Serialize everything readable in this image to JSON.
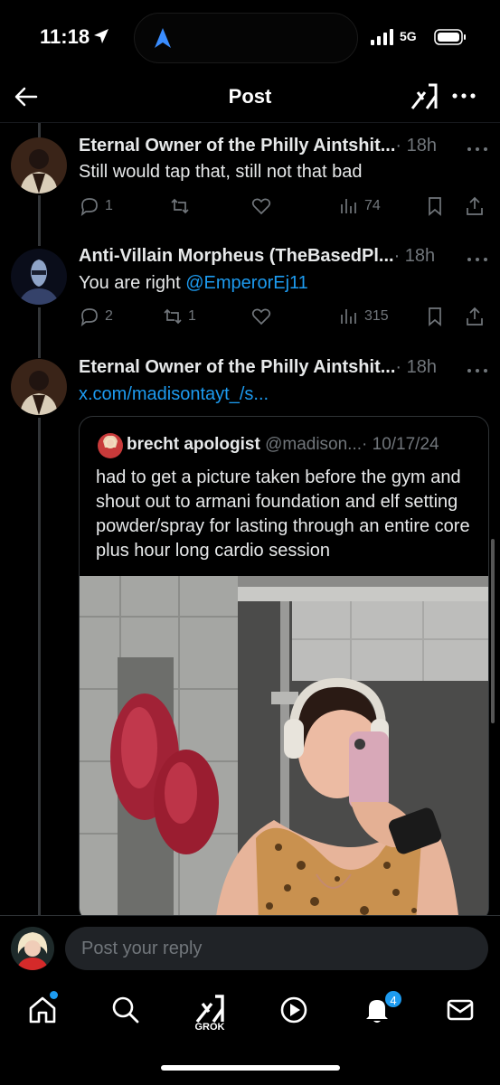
{
  "status_bar": {
    "time": "11:18",
    "network": "5G"
  },
  "header": {
    "title": "Post"
  },
  "tweets": [
    {
      "name": "Eternal Owner of the Philly Aintshit...",
      "time": "· 18h",
      "text": "Still would tap that, still not that bad",
      "replies": "1",
      "retweets": "",
      "likes": "",
      "views": "74"
    },
    {
      "name": "Anti-Villain Morpheus (TheBasedPl...",
      "time": "· 18h",
      "text_prefix": "You are right ",
      "mention": "@EmperorEj11",
      "replies": "2",
      "retweets": "1",
      "likes": "",
      "views": "315"
    },
    {
      "name": "Eternal Owner of the Philly Aintshit...",
      "time": "· 18h",
      "link": "x.com/madisontayt_/s..."
    }
  ],
  "quote": {
    "name": "brecht apologist",
    "handle": "@madison...",
    "date": "· 10/17/24",
    "text": "had to get a picture taken before the gym and shout out to armani foundation and elf setting powder/spray for lasting through an entire core plus hour long cardio session"
  },
  "reply": {
    "placeholder": "Post your reply"
  },
  "tabbar": {
    "grok_label": "GROK",
    "notifications_badge": "4"
  },
  "colors": {
    "accent": "#1d9bf0",
    "muted": "#71767b",
    "text": "#e7e9ea",
    "background": "#000000"
  }
}
